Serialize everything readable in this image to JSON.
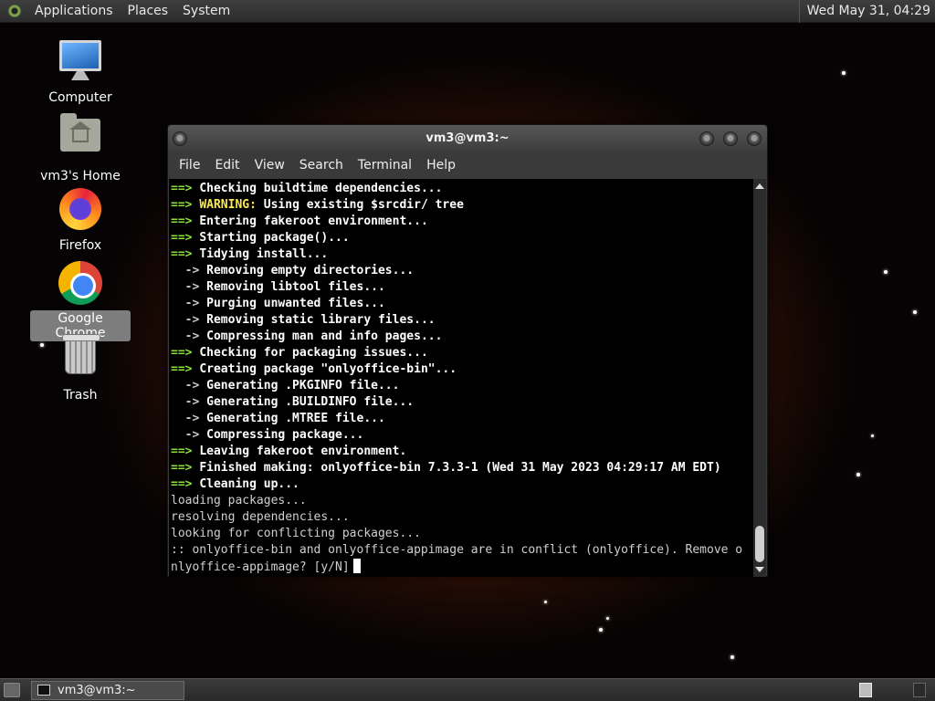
{
  "top_panel": {
    "menus": [
      "Applications",
      "Places",
      "System"
    ],
    "clock": "Wed May 31, 04:29"
  },
  "desktop_icons": [
    {
      "label": "Computer",
      "icon": "computer-icon",
      "selected": false
    },
    {
      "label": "vm3's Home",
      "icon": "home-folder-icon",
      "selected": false
    },
    {
      "label": "Firefox",
      "icon": "firefox-icon",
      "selected": false
    },
    {
      "label": "Google Chrome",
      "icon": "chrome-icon",
      "selected": true
    },
    {
      "label": "Trash",
      "icon": "trash-icon",
      "selected": false
    }
  ],
  "terminal": {
    "title": "vm3@vm3:~",
    "menu": [
      "File",
      "Edit",
      "View",
      "Search",
      "Terminal",
      "Help"
    ],
    "lines": [
      {
        "prefix": "==>",
        "kind": "step",
        "text": "Checking buildtime dependencies..."
      },
      {
        "prefix": "==>",
        "kind": "warn",
        "warn": "WARNING:",
        "text": "Using existing $srcdir/ tree"
      },
      {
        "prefix": "==>",
        "kind": "step",
        "text": "Entering fakeroot environment..."
      },
      {
        "prefix": "==>",
        "kind": "step",
        "text": "Starting package()..."
      },
      {
        "prefix": "==>",
        "kind": "step",
        "text": "Tidying install..."
      },
      {
        "prefix": "  ->",
        "kind": "sub",
        "text": "Removing empty directories..."
      },
      {
        "prefix": "  ->",
        "kind": "sub",
        "text": "Removing libtool files..."
      },
      {
        "prefix": "  ->",
        "kind": "sub",
        "text": "Purging unwanted files..."
      },
      {
        "prefix": "  ->",
        "kind": "sub",
        "text": "Removing static library files..."
      },
      {
        "prefix": "  ->",
        "kind": "sub",
        "text": "Compressing man and info pages..."
      },
      {
        "prefix": "==>",
        "kind": "step",
        "text": "Checking for packaging issues..."
      },
      {
        "prefix": "==>",
        "kind": "step",
        "text": "Creating package \"onlyoffice-bin\"..."
      },
      {
        "prefix": "  ->",
        "kind": "sub",
        "text": "Generating .PKGINFO file..."
      },
      {
        "prefix": "  ->",
        "kind": "sub",
        "text": "Generating .BUILDINFO file..."
      },
      {
        "prefix": "  ->",
        "kind": "sub",
        "text": "Generating .MTREE file..."
      },
      {
        "prefix": "  ->",
        "kind": "sub",
        "text": "Compressing package..."
      },
      {
        "prefix": "==>",
        "kind": "step",
        "text": "Leaving fakeroot environment."
      },
      {
        "prefix": "==>",
        "kind": "step",
        "text": "Finished making: onlyoffice-bin 7.3.3-1 (Wed 31 May 2023 04:29:17 AM EDT)"
      },
      {
        "prefix": "==>",
        "kind": "step",
        "text": "Cleaning up..."
      },
      {
        "prefix": "",
        "kind": "plain",
        "text": "loading packages..."
      },
      {
        "prefix": "",
        "kind": "plain",
        "text": "resolving dependencies..."
      },
      {
        "prefix": "",
        "kind": "plain",
        "text": "looking for conflicting packages..."
      },
      {
        "prefix": "",
        "kind": "plain",
        "text": ":: onlyoffice-bin and onlyoffice-appimage are in conflict (onlyoffice). Remove o"
      },
      {
        "prefix": "",
        "kind": "prompt",
        "text": "nlyoffice-appimage? [y/N]"
      }
    ]
  },
  "bottom_panel": {
    "task": "vm3@vm3:~"
  }
}
